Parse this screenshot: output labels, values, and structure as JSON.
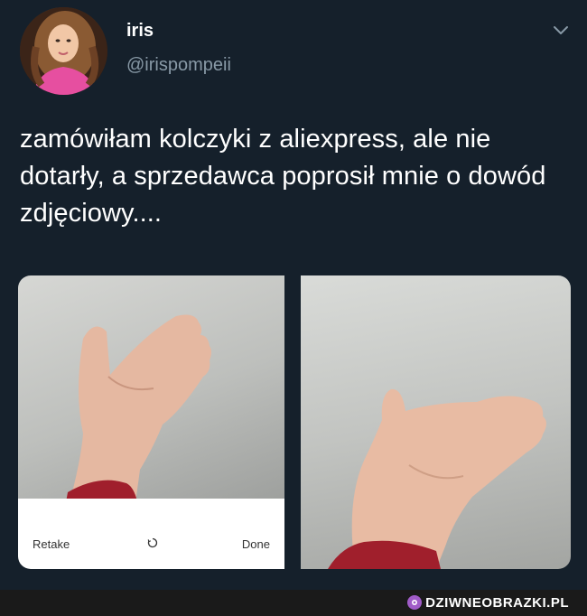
{
  "tweet": {
    "display_name": "iris",
    "handle": "@irispompeii",
    "text": "zamówiłam kolczyki z aliexpress, ale nie dotarły, a sprzedawca poprosił mnie o dowód zdjęciowy...."
  },
  "camera": {
    "retake_label": "Retake",
    "done_label": "Done"
  },
  "watermark": {
    "text": "DZIWNEOBRAZKI.PL",
    "accent": "#a05cc8"
  },
  "colors": {
    "background": "#15202b",
    "handle": "#8899a6"
  },
  "icons": [
    "avatar",
    "chevron-down-icon",
    "spinner-icon",
    "watermark-logo-icon"
  ]
}
